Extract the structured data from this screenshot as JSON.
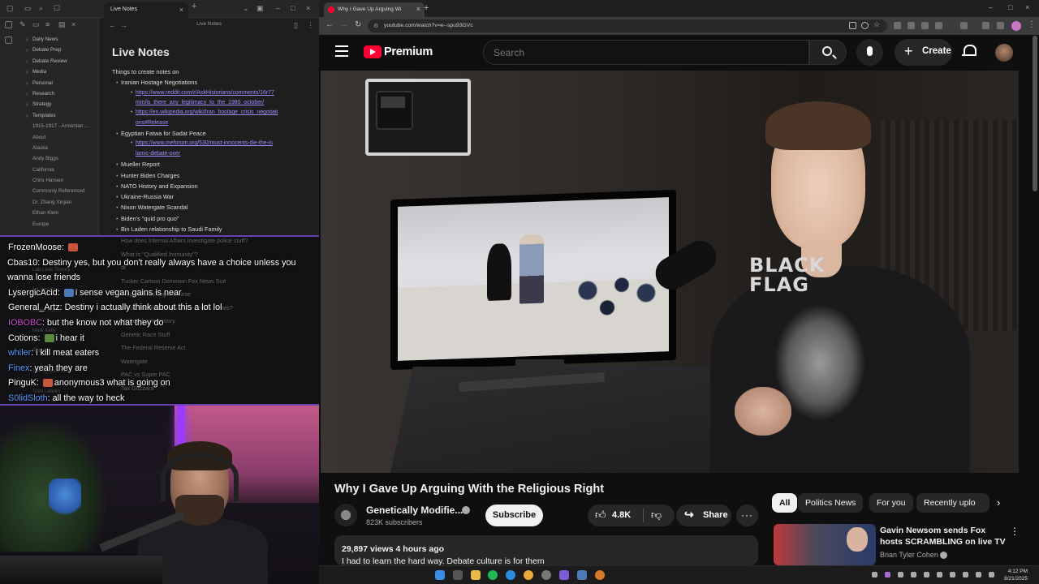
{
  "obsidian": {
    "tab_title": "Live Notes",
    "path": "Live Notes",
    "note_title": "Live Notes",
    "sidebar": [
      {
        "label": "Daily News",
        "type": "folder"
      },
      {
        "label": "Debate Prep",
        "type": "folder"
      },
      {
        "label": "Debate Review",
        "type": "folder"
      },
      {
        "label": "Media",
        "type": "folder"
      },
      {
        "label": "Personal",
        "type": "folder"
      },
      {
        "label": "Research",
        "type": "folder"
      },
      {
        "label": "Strategy",
        "type": "folder"
      },
      {
        "label": "Templates",
        "type": "folder"
      },
      {
        "label": "1915-1917 - Armenian ...",
        "type": "file"
      },
      {
        "label": "About",
        "type": "file"
      },
      {
        "label": "Alaska",
        "type": "file"
      },
      {
        "label": "Andy Biggs",
        "type": "file"
      },
      {
        "label": "California",
        "type": "file"
      },
      {
        "label": "Chris Hansen",
        "type": "file"
      },
      {
        "label": "Commonly Referenced",
        "type": "file"
      },
      {
        "label": "Dr. Zhang Xinjian",
        "type": "file"
      },
      {
        "label": "Ethan Klein",
        "type": "file"
      },
      {
        "label": "Europe",
        "type": "file"
      }
    ],
    "content_heading": "Things to create notes on",
    "items": [
      {
        "text": "Iranian Hostage Negotiations",
        "level": 1
      },
      {
        "text": "https://www.reddit.com/r/AskHistorians/comments/16r77",
        "level": 2,
        "first": true
      },
      {
        "text": "mm/is_there_any_legitimacy_to_the_1980_october/",
        "level": 2
      },
      {
        "text": "https://en.wikipedia.org/wiki/Iran_hostage_crisis_negotiati",
        "level": 2,
        "first": true
      },
      {
        "text": "ons#Release",
        "level": 2
      },
      {
        "text": "Egyptian Fatwa for Sadat Peace",
        "level": 1
      },
      {
        "text": "https://www.meforum.org/530/must-innocents-die-the-is",
        "level": 2,
        "first": true
      },
      {
        "text": "lamic-debate-over",
        "level": 2
      },
      {
        "text": "Mueller Report",
        "level": 1
      },
      {
        "text": "Hunter Biden Charges",
        "level": 1
      },
      {
        "text": "NATO History and Expansion",
        "level": 1
      },
      {
        "text": "Ukraine-Russia War",
        "level": 1
      },
      {
        "text": "Nixon Watergate Scandal",
        "level": 1
      },
      {
        "text": "Biden's \"quid pro quo\"",
        "level": 1
      },
      {
        "text": "Bin Laden relationship to Saudi Family",
        "level": 1
      }
    ],
    "ghost_items": [
      "How does Internal Affairs investigate police stuff?",
      "What is \"Qualified Immunity\"?",
      "dr",
      "Tucker Carlson Dominion Fox News Suit",
      "Propositional Logic Course",
      "Who Classified things in the United States?",
      "Vegas shooting story",
      "Genetic Race Stuff",
      "The Federal Reserve Act",
      "Watergate",
      "PAC vs Super PAC",
      "Tax Guzzara"
    ],
    "ghost_sidebar": [
      "Kalen Palek",
      "Lab Leak Theory",
      "Liz Wheeler",
      "Marco Rubio",
      "Mark Kelly",
      "Roblox",
      "The Epstein Story",
      "Tomi Lahren"
    ]
  },
  "chat": {
    "messages": [
      {
        "user": "FrozenMoose",
        "color": "white",
        "text": " "
      },
      {
        "user": "Cbas10",
        "color": "white",
        "text": "Destiny yes, but you don't really always have a choice unless you wanna lose friends"
      },
      {
        "user": "LysergicAcid",
        "color": "white",
        "text": "i sense vegan gains is near"
      },
      {
        "user": "General_Artz",
        "color": "white",
        "text": "Destiny i actually think about this a lot lol"
      },
      {
        "user": "IOBOBC",
        "color": "pink",
        "text": "but the know not what they do"
      },
      {
        "user": "Cotions",
        "color": "white",
        "text": "i hear it"
      },
      {
        "user": "whiler",
        "color": "blue",
        "text": "i kill meat eaters"
      },
      {
        "user": "Finex",
        "color": "blue",
        "text": "yeah they are"
      },
      {
        "user": "PinguK",
        "color": "white",
        "text": "anonymous3 what is going on"
      },
      {
        "user": "S0lidSloth",
        "color": "blue",
        "text": "all the way to heck"
      }
    ]
  },
  "browser": {
    "tab_title": "Why I Gave Up Arguing Wi",
    "url": "youtube.com/watch?v=e--spu93GVc"
  },
  "youtube": {
    "brand": "Premium",
    "search_placeholder": "Search",
    "create_label": "Create",
    "video": {
      "title": "Why I Gave Up Arguing With the Religious Right",
      "channel": "Genetically Modifie...",
      "subscribers": "823K subscribers",
      "subscribe_label": "Subscribe",
      "likes": "4.8K",
      "share_label": "Share",
      "views_time": "29,897 views  4 hours ago",
      "description": "I had to learn the hard way. Debate culture is for them",
      "shirt_text_1": "BLACK",
      "shirt_text_2": "FLAG"
    },
    "chips": [
      "All",
      "Politics News",
      "For you",
      "Recently uplo"
    ],
    "recommended": {
      "title": "Gavin Newsom sends Fox hosts SCRAMBLING on live TV",
      "channel": "Brian Tyler Cohen"
    }
  },
  "taskbar": {
    "time": "4:12 PM",
    "date": "8/21/2025"
  },
  "colors": {
    "youtube_red": "#ff0033",
    "link": "#9c8cff",
    "chat_blue": "#5b9dff",
    "chat_pink": "#d04bd4",
    "stream_border": "#6a3fb0"
  }
}
